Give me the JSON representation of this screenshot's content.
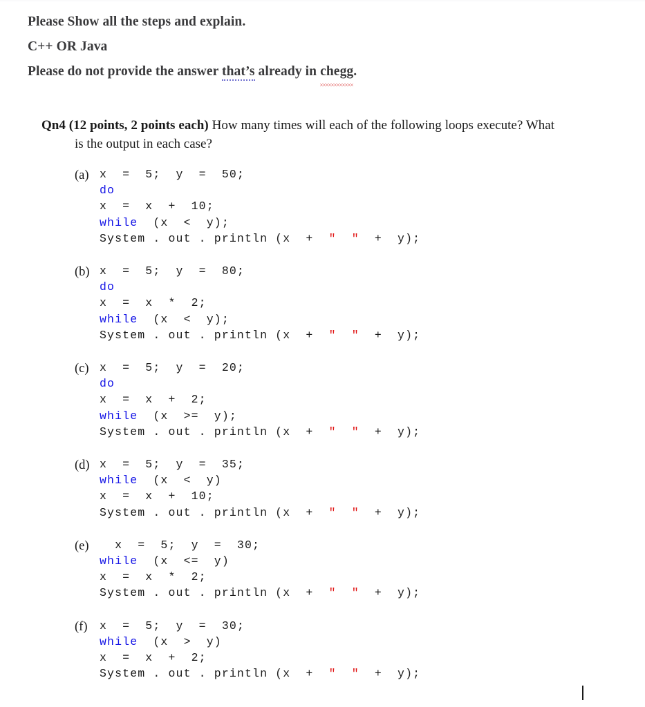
{
  "prompt": {
    "line1": "Please Show all the steps and explain.",
    "line2": "C++ OR Java",
    "line3_pre": "Please do not provide the answer ",
    "line3_grammar": "that’s",
    "line3_mid": " already in ",
    "line3_spell": "chegg",
    "line3_end": "."
  },
  "question": {
    "label": "Qn4 (12 points, 2 points each)",
    "body": " How many times will each of the following loops execute? What is the output in each case?"
  },
  "colors": {
    "keyword": "#1414e6",
    "string": "#e01010",
    "prompt_text": "#3a3a3c",
    "body_text": "#1a1a1a",
    "grammar_underline": "#6f6fd0",
    "spell_underline": "#d83a3a"
  },
  "items": [
    {
      "label": "(a)",
      "lines": [
        [
          {
            "t": "x  =  5;  y  =  50;",
            "c": "plain"
          }
        ],
        [
          {
            "t": "do",
            "c": "kw"
          }
        ],
        [
          {
            "t": "x  =  x  +  10;",
            "c": "plain"
          }
        ],
        [
          {
            "t": "while",
            "c": "kw"
          },
          {
            "t": "  (x  <  y);",
            "c": "plain"
          }
        ],
        [
          {
            "t": "System . out . println (x  +  ",
            "c": "plain"
          },
          {
            "t": "\"  \"",
            "c": "str"
          },
          {
            "t": "  +  y);",
            "c": "plain"
          }
        ]
      ]
    },
    {
      "label": "(b)",
      "lines": [
        [
          {
            "t": "x  =  5;  y  =  80;",
            "c": "plain"
          }
        ],
        [
          {
            "t": "do",
            "c": "kw"
          }
        ],
        [
          {
            "t": "x  =  x  *  2;",
            "c": "plain"
          }
        ],
        [
          {
            "t": "while",
            "c": "kw"
          },
          {
            "t": "  (x  <  y);",
            "c": "plain"
          }
        ],
        [
          {
            "t": "System . out . println (x  +  ",
            "c": "plain"
          },
          {
            "t": "\"  \"",
            "c": "str"
          },
          {
            "t": "  +  y);",
            "c": "plain"
          }
        ]
      ]
    },
    {
      "label": "(c)",
      "lines": [
        [
          {
            "t": "x  =  5;  y  =  20;",
            "c": "plain"
          }
        ],
        [
          {
            "t": "do",
            "c": "kw"
          }
        ],
        [
          {
            "t": "x  =  x  +  2;",
            "c": "plain"
          }
        ],
        [
          {
            "t": "while",
            "c": "kw"
          },
          {
            "t": "  (x  >=  y);",
            "c": "plain"
          }
        ],
        [
          {
            "t": "System . out . println (x  +  ",
            "c": "plain"
          },
          {
            "t": "\"  \"",
            "c": "str"
          },
          {
            "t": "  +  y);",
            "c": "plain"
          }
        ]
      ]
    },
    {
      "label": "(d)",
      "lines": [
        [
          {
            "t": "x  =  5;  y  =  35;",
            "c": "plain"
          }
        ],
        [
          {
            "t": "while",
            "c": "kw"
          },
          {
            "t": "  (x  <  y)",
            "c": "plain"
          }
        ],
        [
          {
            "t": "x  =  x  +  10;",
            "c": "plain"
          }
        ],
        [
          {
            "t": "System . out . println (x  +  ",
            "c": "plain"
          },
          {
            "t": "\"  \"",
            "c": "str"
          },
          {
            "t": "  +  y);",
            "c": "plain"
          }
        ]
      ]
    },
    {
      "label": "(e)",
      "lines": [
        [
          {
            "t": "  x  =  5;  y  =  30;",
            "c": "plain"
          }
        ],
        [
          {
            "t": "while",
            "c": "kw"
          },
          {
            "t": "  (x  <=  y)",
            "c": "plain"
          }
        ],
        [
          {
            "t": "x  =  x  *  2;",
            "c": "plain"
          }
        ],
        [
          {
            "t": "System . out . println (x  +  ",
            "c": "plain"
          },
          {
            "t": "\"  \"",
            "c": "str"
          },
          {
            "t": "  +  y);",
            "c": "plain"
          }
        ]
      ]
    },
    {
      "label": "(f)",
      "lines": [
        [
          {
            "t": "x  =  5;  y  =  30;",
            "c": "plain"
          }
        ],
        [
          {
            "t": "while",
            "c": "kw"
          },
          {
            "t": "  (x  >  y)",
            "c": "plain"
          }
        ],
        [
          {
            "t": "x  =  x  +  2;",
            "c": "plain"
          }
        ],
        [
          {
            "t": "System . out . println (x  +  ",
            "c": "plain"
          },
          {
            "t": "\"  \"",
            "c": "str"
          },
          {
            "t": "  +  y);",
            "c": "plain"
          }
        ]
      ]
    }
  ]
}
